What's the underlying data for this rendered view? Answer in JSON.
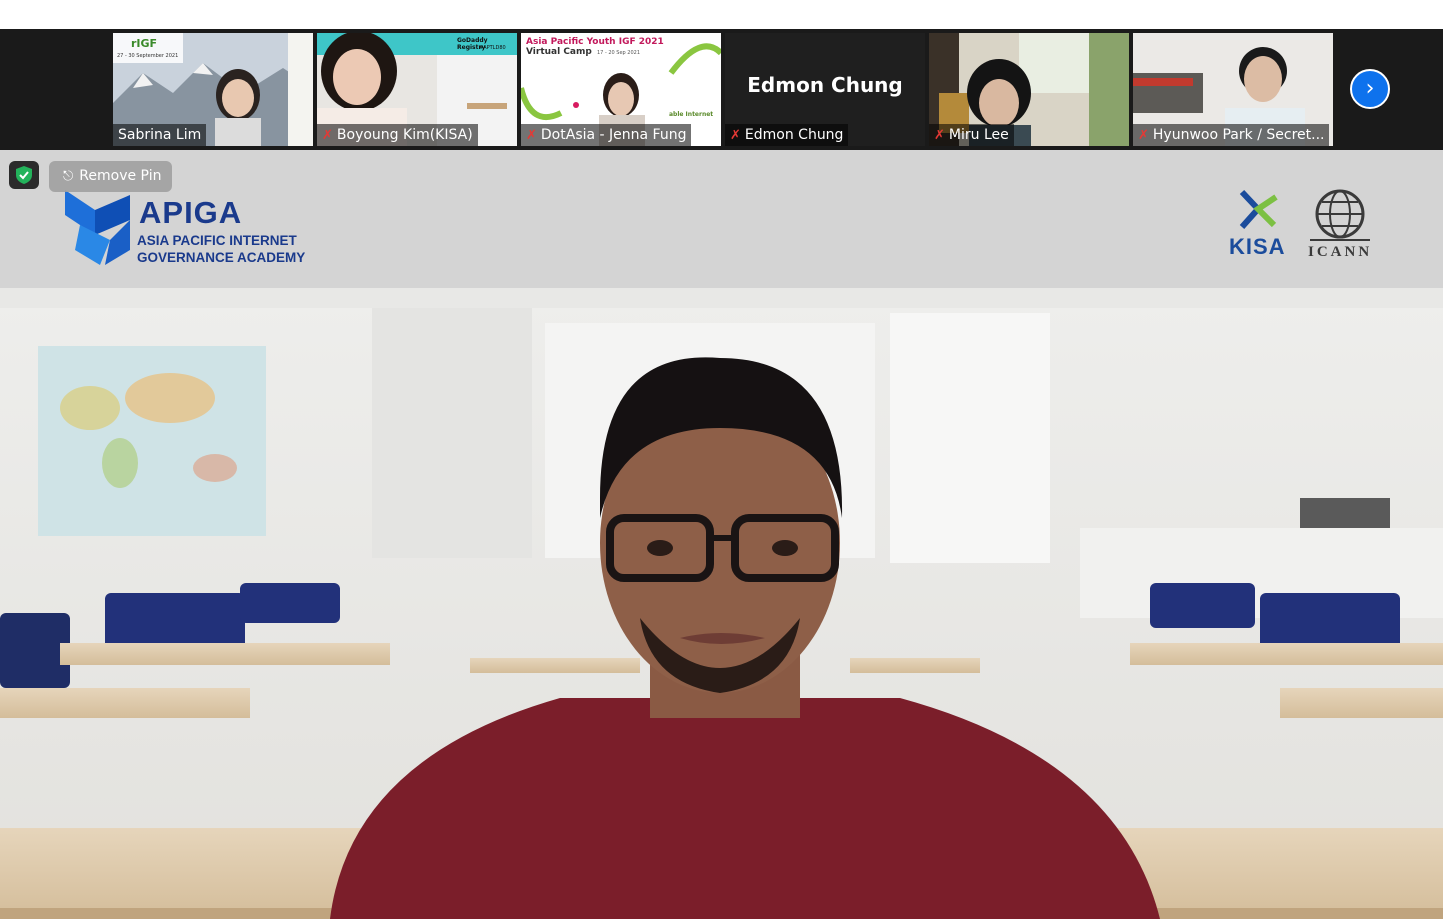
{
  "participants": [
    {
      "name": "Sabrina Lim",
      "muted": false
    },
    {
      "name": "Boyoung Kim(KISA)",
      "muted": true
    },
    {
      "name": "DotAsia - Jenna Fung",
      "muted": true
    },
    {
      "name": "Edmon Chung",
      "muted": true,
      "avatar_text": "Edmon Chung"
    },
    {
      "name": "Miru Lee",
      "muted": true
    },
    {
      "name": "Hyunwoo Park / Secret...",
      "muted": true
    }
  ],
  "thumb_text": {
    "sabrina_rigf": "rIGF",
    "sabrina_dates": "27 - 30 September 2021",
    "boyoung_brand": "GoDaddy Registry",
    "boyoung_tag": "#APTLD80",
    "jenna_title": "Asia Pacific Youth IGF 2021",
    "jenna_sub": "Virtual Camp",
    "jenna_dates": "17 - 20 Sep 2021",
    "jenna_side": "able Internet"
  },
  "controls": {
    "next_page_icon": "chevron-right-icon",
    "security_icon": "shield-check-icon",
    "remove_pin_label": "Remove Pin",
    "pin_icon": "pin-icon"
  },
  "banner": {
    "apiga_title": "APIGA",
    "apiga_line1": "ASIA PACIFIC INTERNET",
    "apiga_line2": "GOVERNANCE ACADEMY",
    "kisa_label": "KISA",
    "icann_label": "ICANN"
  },
  "colors": {
    "strip_bg": "#1a1a1a",
    "accent_blue": "#0e72ed",
    "muted_red": "#e53935",
    "banner_bg": "#d4d4d4",
    "apiga_blue": "#1a3a8c",
    "shirt": "#7b1e2a"
  }
}
